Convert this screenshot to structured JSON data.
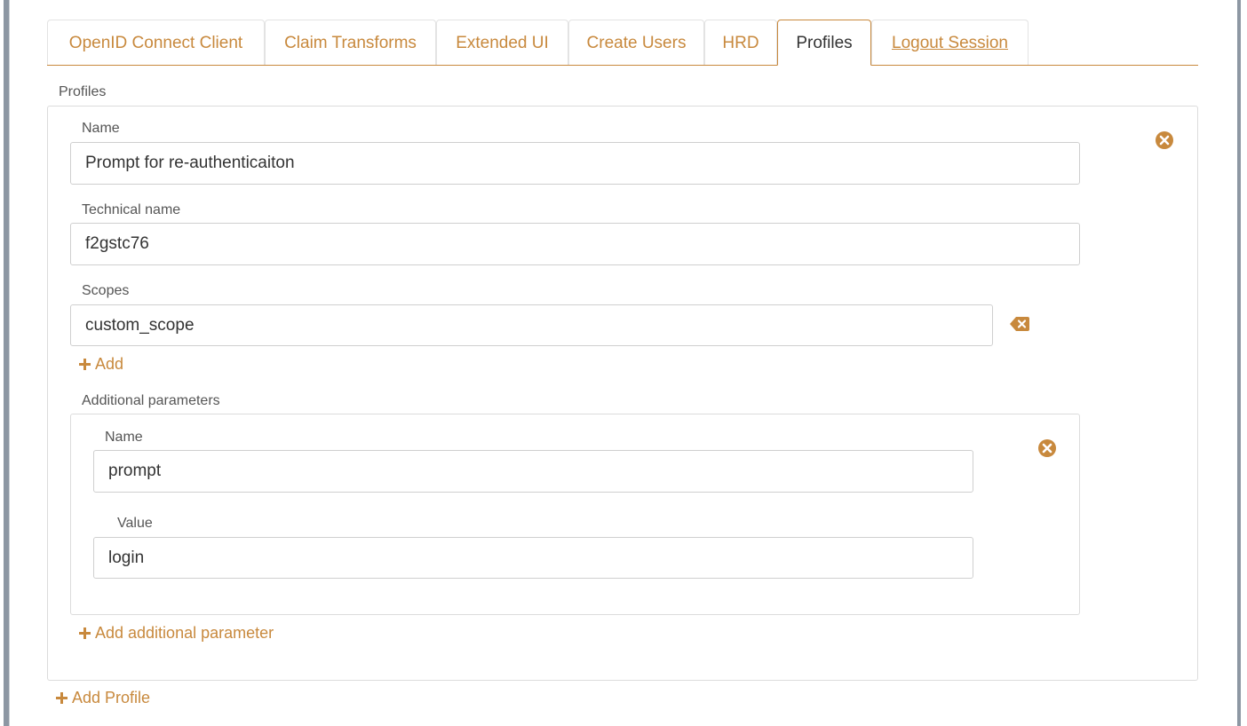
{
  "tabs": [
    {
      "label": "OpenID Connect Client"
    },
    {
      "label": "Claim Transforms"
    },
    {
      "label": "Extended UI"
    },
    {
      "label": "Create Users"
    },
    {
      "label": "HRD"
    },
    {
      "label": "Profiles"
    },
    {
      "label": "Logout Session"
    }
  ],
  "active_tab": "Profiles",
  "profiles": {
    "section_label": "Profiles",
    "profile": {
      "name_label": "Name",
      "name_value": "Prompt for re-authenticaiton",
      "technical_name_label": "Technical name",
      "technical_name_value": "f2gstc76",
      "scopes_label": "Scopes",
      "scope_value": "custom_scope",
      "add_scope_label": "Add",
      "additional_parameters_label": "Additional parameters",
      "parameter": {
        "name_label": "Name",
        "name_value": "prompt",
        "value_label": "Value",
        "value_value": "login"
      },
      "add_parameter_label": "Add additional parameter"
    },
    "add_profile_label": "Add Profile"
  },
  "colors": {
    "accent": "#c8893d",
    "border": "#dcdcdc",
    "text": "#333333"
  },
  "icons": {
    "remove_profile": "close-circle-icon",
    "remove_scope": "backspace-icon",
    "remove_parameter": "close-circle-icon",
    "add": "plus-icon"
  }
}
